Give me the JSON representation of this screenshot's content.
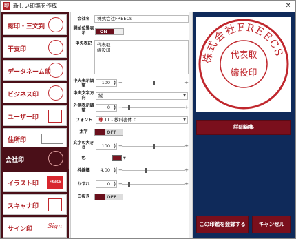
{
  "window": {
    "title": "新しい印鑑を作成",
    "app_icon": "印"
  },
  "categories": [
    {
      "label": "認印・三文判",
      "thumb": "round"
    },
    {
      "label": "干支印",
      "thumb": "round"
    },
    {
      "label": "データネーム印",
      "thumb": "round"
    },
    {
      "label": "ビジネス印",
      "thumb": "round"
    },
    {
      "label": "ユーザー印",
      "thumb": "square"
    },
    {
      "label": "住所印",
      "thumb": "rect"
    },
    {
      "label": "会社印",
      "thumb": "round"
    },
    {
      "label": "イラスト印",
      "thumb": "fill",
      "thumb_text": "FREECS"
    },
    {
      "label": "スキャナ印",
      "thumb": "square"
    },
    {
      "label": "サイン印",
      "thumb": "script",
      "thumb_text": "Sign"
    }
  ],
  "selected_category": "会社印",
  "form": {
    "company_name_label": "会社名",
    "company_name_value": "株式会社FREECS",
    "start_pos_label": "開始位置表示",
    "start_pos_toggle": "ON",
    "center_text_label": "中央表記",
    "center_text_lines": [
      "代表取",
      "締役印"
    ],
    "center_size_label": "中央表示調整",
    "center_size_value": "100",
    "center_dir_label": "中央文字方向",
    "center_dir_value": "縦",
    "outer_adjust_label": "外側表示調整",
    "outer_adjust_value": "0",
    "font_label": "フォント",
    "font_value": "TT - 教科書体 0",
    "font_mark": "尊",
    "bold_label": "太字",
    "bold_toggle": "OFF",
    "char_size_label": "文字の大きさ",
    "char_size_value": "100",
    "color_label": "色",
    "color_hex": "#7a1520",
    "frame_width_label": "枠線幅",
    "frame_width_value": "4.00",
    "blur_label": "かすれ",
    "blur_value": "0",
    "invert_label": "白抜き",
    "invert_toggle": "OFF"
  },
  "preview": {
    "outer_text": "株式会社FREECS",
    "inner_text": "代表取締役印",
    "stamp_color": "#c0272d"
  },
  "buttons": {
    "detail_edit": "詳細編集",
    "register": "この印鑑を登録する",
    "cancel": "キャンセル"
  }
}
